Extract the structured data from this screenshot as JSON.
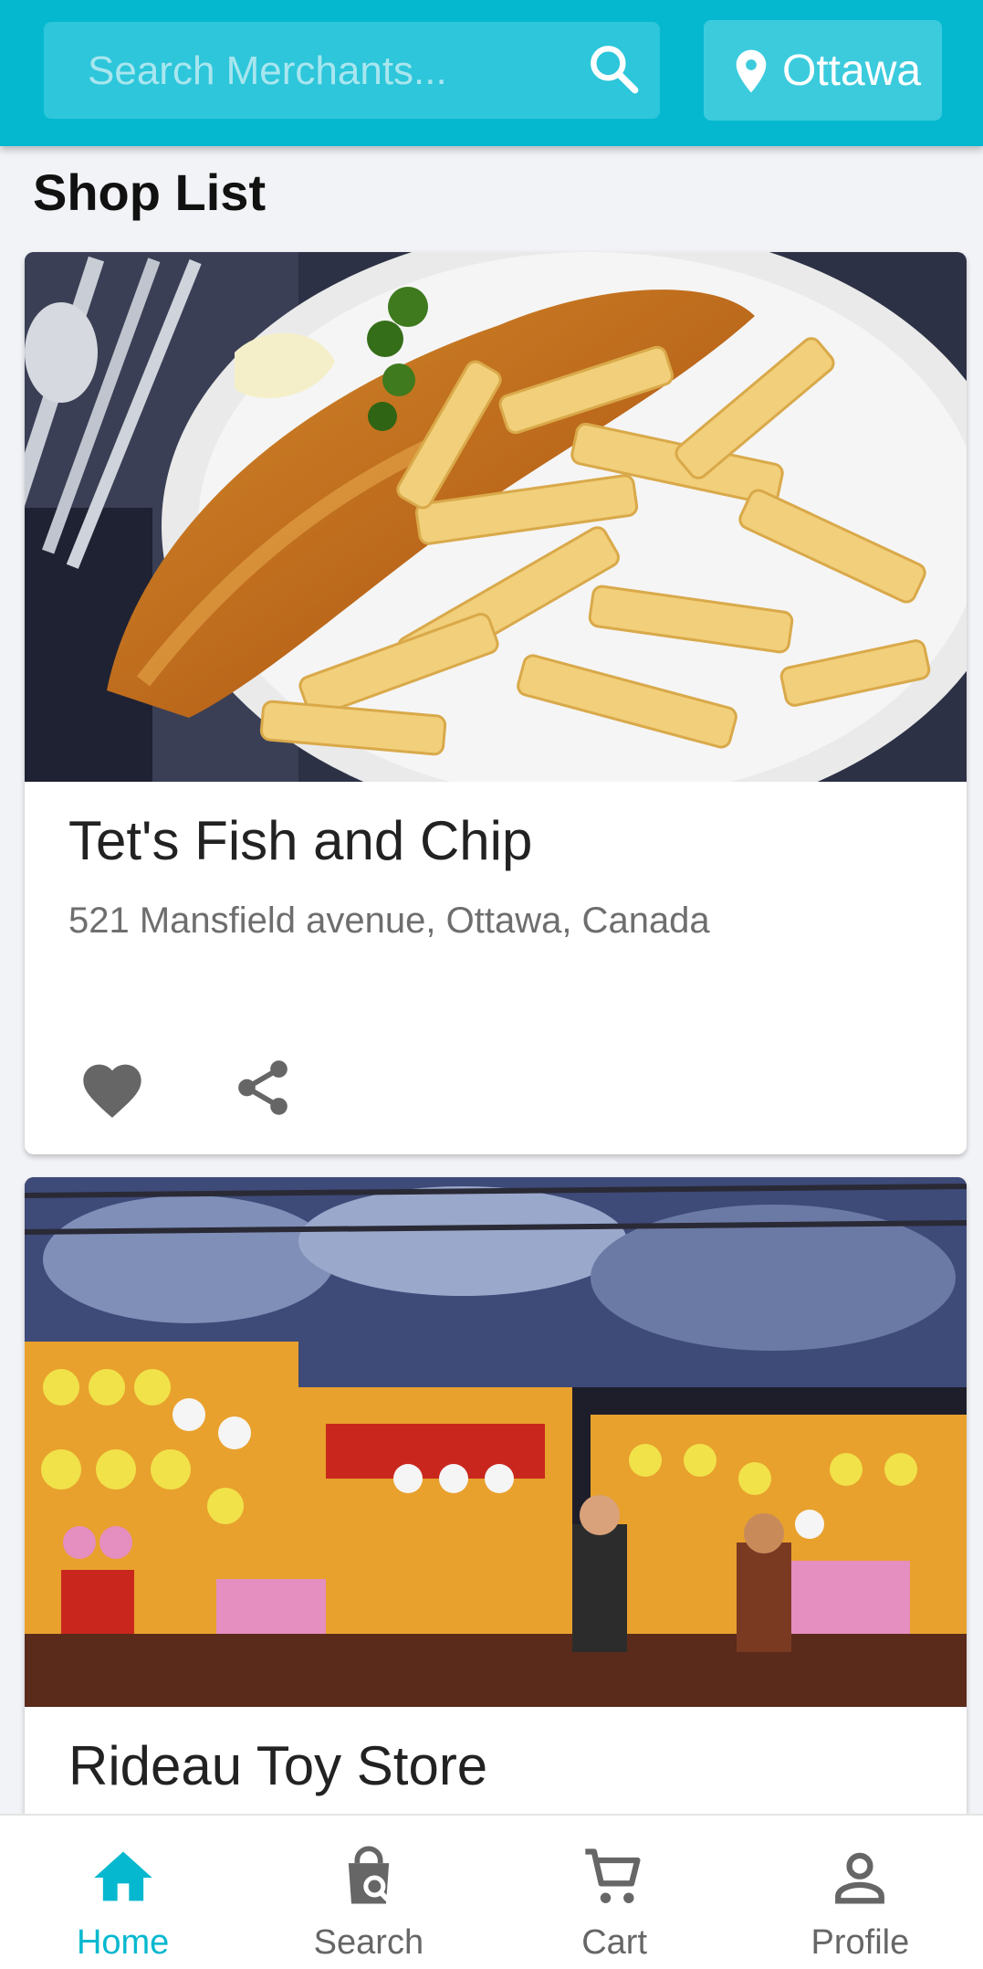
{
  "header": {
    "search_placeholder": "Search Merchants...",
    "location": "Ottawa",
    "accent_color": "#06b8cf"
  },
  "page": {
    "title": "Shop List"
  },
  "shops": [
    {
      "name": "Tet's Fish and Chip",
      "address": "521 Mansfield avenue, Ottawa, Canada",
      "image": "fish-and-chips-photo",
      "actions": [
        "heart-icon",
        "share-icon"
      ]
    },
    {
      "name": "Rideau Toy Store",
      "image": "toy-store-photo"
    }
  ],
  "bottom_nav": {
    "active": "Home",
    "items": [
      {
        "label": "Home",
        "icon": "home-icon"
      },
      {
        "label": "Search",
        "icon": "shopping-bag-search-icon"
      },
      {
        "label": "Cart",
        "icon": "cart-icon"
      },
      {
        "label": "Profile",
        "icon": "person-icon"
      }
    ]
  }
}
